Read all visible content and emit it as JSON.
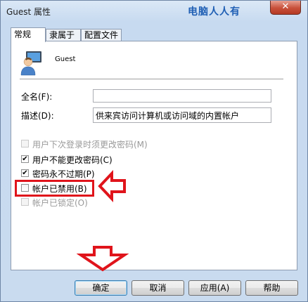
{
  "window": {
    "title": "Guest 属性",
    "watermark": "电脑人人有",
    "close_label": "✕"
  },
  "tabs": [
    {
      "label": "常规",
      "active": true
    },
    {
      "label": "隶属于",
      "active": false
    },
    {
      "label": "配置文件",
      "active": false
    }
  ],
  "user": {
    "name": "Guest"
  },
  "fields": {
    "fullname_label": "全名(F):",
    "fullname_value": "",
    "description_label": "描述(D):",
    "description_value": "供来宾访问计算机或访问域的内置帐户"
  },
  "checkboxes": [
    {
      "label": "用户下次登录时须更改密码(M)",
      "checked": false,
      "enabled": false
    },
    {
      "label": "用户不能更改密码(C)",
      "checked": true,
      "enabled": true
    },
    {
      "label": "密码永不过期(P)",
      "checked": true,
      "enabled": true
    },
    {
      "label": "帐户已禁用(B)",
      "checked": false,
      "enabled": true
    },
    {
      "label": "帐户已锁定(O)",
      "checked": false,
      "enabled": false
    }
  ],
  "buttons": {
    "ok": "确定",
    "cancel": "取消",
    "apply": "应用(A)",
    "help": "帮助"
  },
  "colors": {
    "annotation": "#e0141b",
    "accent": "#1f5fb4"
  },
  "icons": {
    "check": "✔"
  }
}
